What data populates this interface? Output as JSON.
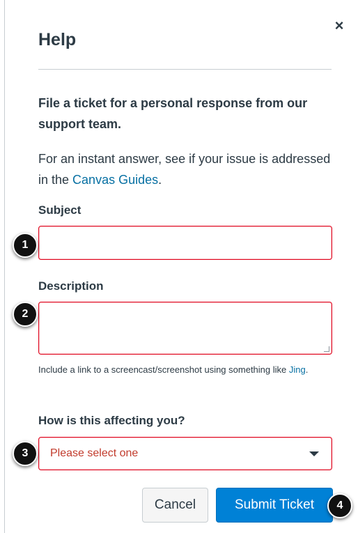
{
  "dialog": {
    "title": "Help",
    "close_symbol": "×"
  },
  "intro": {
    "heading": "File a ticket for a personal response from our support team.",
    "instant_prefix": "For an instant answer, see if your issue is addressed in the ",
    "instant_link": "Canvas Guides",
    "instant_suffix": "."
  },
  "form": {
    "subject_label": "Subject",
    "subject_value": "",
    "description_label": "Description",
    "description_value": "",
    "help_prefix": "Include a link to a screencast/screenshot using something like ",
    "help_link": "Jing",
    "help_suffix": ".",
    "impact_label": "How is this affecting you?",
    "impact_selected": "Please select one"
  },
  "buttons": {
    "cancel": "Cancel",
    "submit": "Submit Ticket"
  },
  "callouts": [
    "1",
    "2",
    "3",
    "4"
  ],
  "colors": {
    "error_border": "#e0061f",
    "link": "#0770a3",
    "primary_button": "#0081d6",
    "placeholder_error_text": "#c23c2d"
  }
}
